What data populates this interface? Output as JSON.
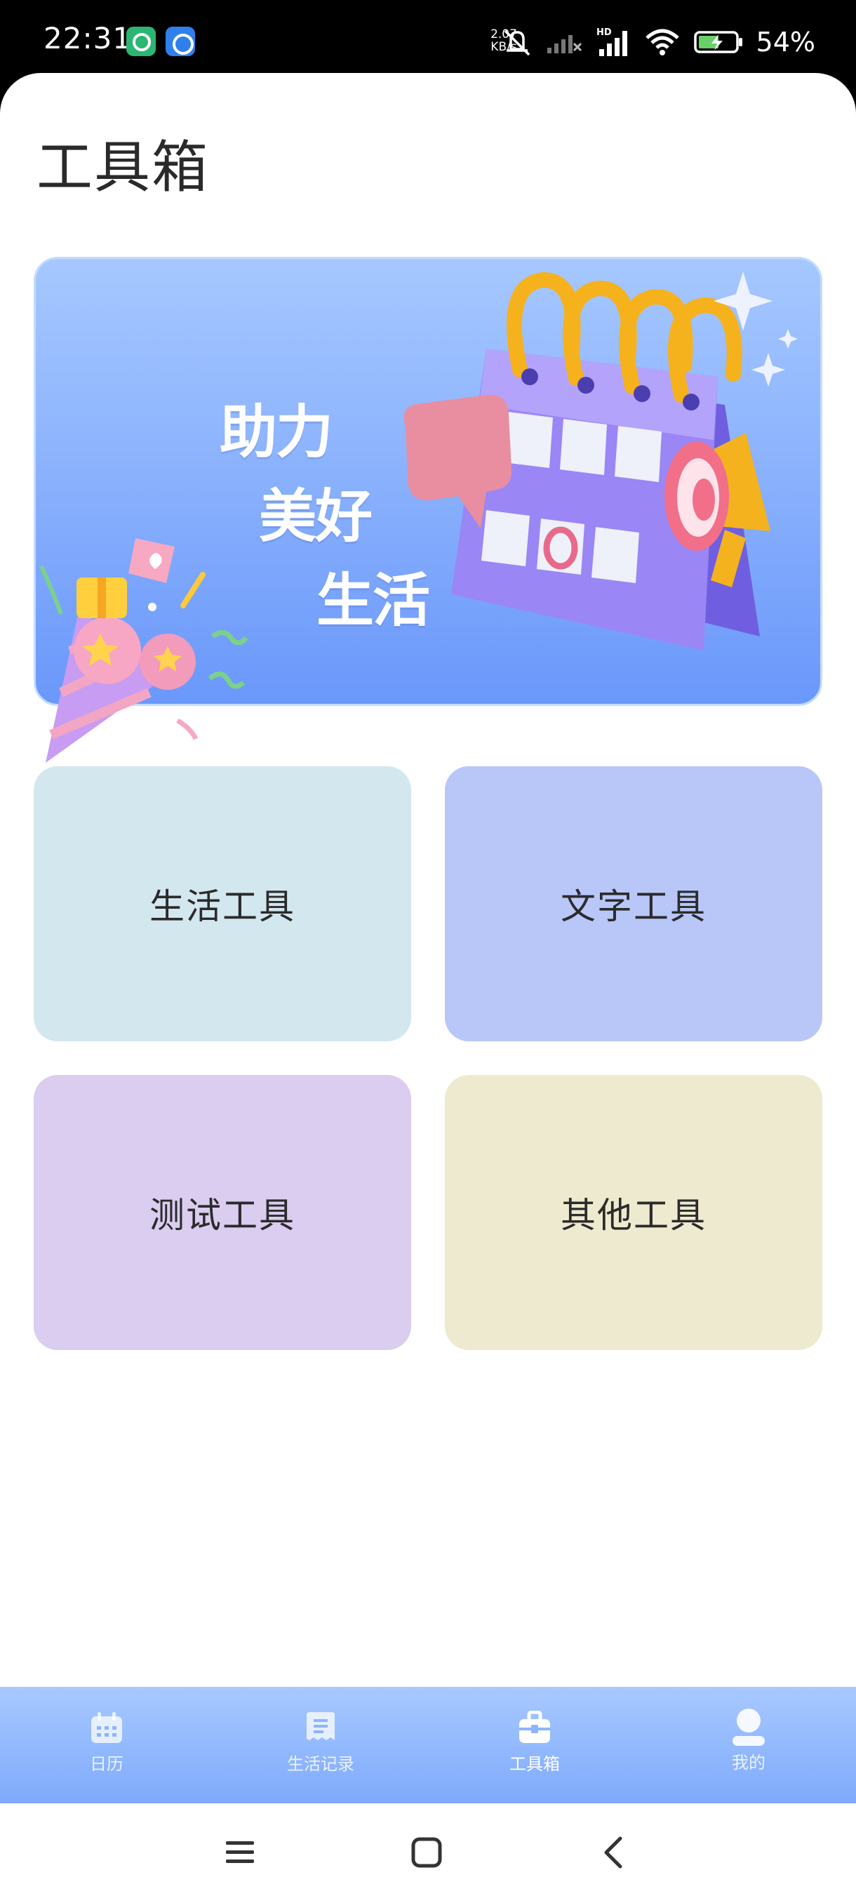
{
  "status_bar": {
    "time": "22:31",
    "net_speed_value": "2.07",
    "net_speed_unit": "KB/s",
    "network_type": "HD",
    "battery_percent": "54%",
    "icons": [
      "app-icon-green",
      "app-icon-blue",
      "mute-icon",
      "signal-icon",
      "signal-hd-icon",
      "wifi-icon",
      "battery-charging-icon"
    ]
  },
  "page": {
    "title": "工具箱"
  },
  "banner": {
    "slogan_line1": "助力",
    "slogan_line2": "美好",
    "slogan_line3": "生活"
  },
  "tools": [
    {
      "label": "生活工具",
      "color": "#d3e7ef"
    },
    {
      "label": "文字工具",
      "color": "#b9c7f8"
    },
    {
      "label": "测试工具",
      "color": "#dacdf0"
    },
    {
      "label": "其他工具",
      "color": "#eeeacf"
    }
  ],
  "tabbar": {
    "items": [
      {
        "label": "日历",
        "icon": "calendar-icon",
        "active": false
      },
      {
        "label": "生活记录",
        "icon": "notes-icon",
        "active": false
      },
      {
        "label": "工具箱",
        "icon": "toolbox-icon",
        "active": true
      },
      {
        "label": "我的",
        "icon": "user-icon",
        "active": false
      }
    ]
  },
  "system_nav": {
    "buttons": [
      "menu-icon",
      "home-icon",
      "back-icon"
    ]
  }
}
